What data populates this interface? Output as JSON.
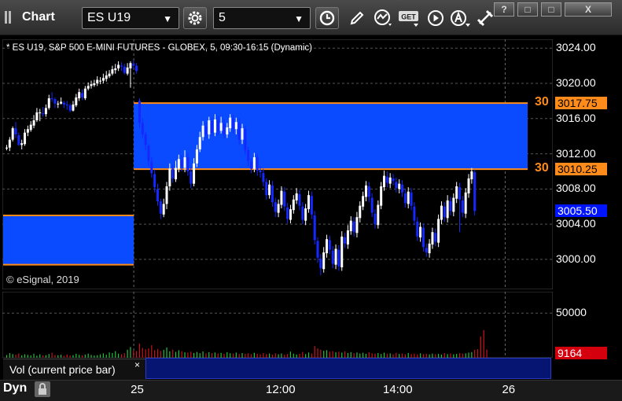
{
  "window": {
    "title": "Chart",
    "symbol": "ES U19",
    "interval": "5",
    "help_btn": "?",
    "restore_btn": "□",
    "maximize_btn": "□",
    "close_btn": "X"
  },
  "chart_info": "* ES U19, S&P 500 E-MINI FUTURES - GLOBEX, 5, 09:30-16:15 (Dynamic)",
  "copyright": "© eSignal, 2019",
  "box_label_top": "30",
  "box_label_bottom": "30",
  "price_tags": {
    "top_box": "3017.75",
    "bottom_box": "3010.25",
    "last": "3005.50",
    "volume": "9164"
  },
  "volume_pane": {
    "label": "Vol (current price bar)",
    "close": "×"
  },
  "bottom_bar": {
    "mode": "Dyn"
  },
  "colors": {
    "box": "#0a4bff",
    "box_border": "#ff8c1a",
    "up_candle": "#ffffff",
    "down_candle": "#1428ff",
    "vol_up": "#22c23a",
    "vol_down": "#c8141e",
    "last_tag": "#0014ff",
    "vol_tag": "#d4000e"
  },
  "chart_data": {
    "type": "candlestick",
    "price_axis": {
      "ticks": [
        "3024.00",
        "3020.00",
        "3016.00",
        "3012.00",
        "3008.00",
        "3004.00",
        "3000.00"
      ],
      "range": [
        2996.6,
        3025.0
      ]
    },
    "volume_axis": {
      "ticks": [
        "50000"
      ],
      "range": [
        0,
        74000
      ]
    },
    "time_axis": {
      "ticks": [
        "25",
        "12:00",
        "14:00",
        "26"
      ]
    },
    "boxes": [
      {
        "from_bar": 43,
        "to_bar": 150,
        "high": 3017.75,
        "low": 3010.25
      },
      {
        "from_bar": 0,
        "to_bar": 43,
        "high": 3005.0,
        "low": 2999.4
      }
    ],
    "day_separators": [
      43,
      166
    ],
    "candles": [
      [
        3012.6,
        3012.7,
        3013.0,
        3012.4
      ],
      [
        3012.7,
        3013.6,
        3013.9,
        3012.3
      ],
      [
        3013.6,
        3014.9,
        3015.1,
        3013.4
      ],
      [
        3014.9,
        3014.2,
        3015.6,
        3013.8
      ],
      [
        3014.1,
        3013.0,
        3014.4,
        3012.9
      ],
      [
        3013.0,
        3013.2,
        3013.6,
        3012.5
      ],
      [
        3013.1,
        3014.4,
        3014.8,
        3012.9
      ],
      [
        3014.4,
        3014.8,
        3015.2,
        3014.0
      ],
      [
        3014.7,
        3015.3,
        3015.7,
        3014.5
      ],
      [
        3015.2,
        3015.8,
        3016.4,
        3014.9
      ],
      [
        3015.8,
        3016.7,
        3017.2,
        3015.6
      ],
      [
        3016.6,
        3016.7,
        3017.1,
        3015.7
      ],
      [
        3016.6,
        3016.5,
        3017.3,
        3016.2
      ],
      [
        3016.5,
        3017.2,
        3017.6,
        3016.2
      ],
      [
        3017.2,
        3018.3,
        3018.7,
        3017.0
      ],
      [
        3018.3,
        3018.2,
        3019.0,
        3017.9
      ],
      [
        3018.2,
        3017.7,
        3018.4,
        3017.2
      ],
      [
        3017.6,
        3017.7,
        3018.0,
        3017.2
      ],
      [
        3017.7,
        3017.9,
        3018.4,
        3017.6
      ],
      [
        3017.8,
        3017.6,
        3018.0,
        3017.2
      ],
      [
        3017.6,
        3017.5,
        3018.0,
        3017.0
      ],
      [
        3017.5,
        3016.9,
        3017.7,
        3016.7
      ],
      [
        3016.9,
        3017.6,
        3018.0,
        3016.8
      ],
      [
        3017.5,
        3018.4,
        3018.8,
        3017.3
      ],
      [
        3018.3,
        3019.0,
        3019.4,
        3018.0
      ],
      [
        3018.9,
        3018.4,
        3019.3,
        3018.1
      ],
      [
        3018.3,
        3019.4,
        3019.7,
        3018.1
      ],
      [
        3019.4,
        3019.7,
        3020.1,
        3019.2
      ],
      [
        3019.7,
        3019.9,
        3020.3,
        3019.4
      ],
      [
        3019.8,
        3020.0,
        3020.4,
        3019.6
      ],
      [
        3020.0,
        3020.4,
        3020.8,
        3019.7
      ],
      [
        3020.3,
        3020.3,
        3020.7,
        3019.9
      ],
      [
        3020.3,
        3020.6,
        3021.1,
        3020.0
      ],
      [
        3020.5,
        3020.9,
        3021.4,
        3020.2
      ],
      [
        3020.8,
        3021.1,
        3021.5,
        3020.6
      ],
      [
        3021.1,
        3021.6,
        3022.0,
        3020.9
      ],
      [
        3021.5,
        3021.7,
        3022.2,
        3021.1
      ],
      [
        3021.7,
        3022.1,
        3022.5,
        3021.4
      ],
      [
        3022.0,
        3021.9,
        3022.4,
        3021.4
      ],
      [
        3021.9,
        3021.2,
        3022.2,
        3021.0
      ],
      [
        3021.1,
        3021.8,
        3022.3,
        3020.9
      ],
      [
        3021.7,
        3022.3,
        3022.5,
        3019.5
      ],
      [
        3022.2,
        3022.0,
        3022.6,
        3021.6
      ],
      [
        3022.0,
        3021.4,
        3022.3,
        3021.1
      ],
      [
        3018.0,
        3015.5,
        3018.3,
        3014.9
      ],
      [
        3015.5,
        3014.2,
        3016.0,
        3013.8
      ],
      [
        3014.2,
        3013.0,
        3014.5,
        3012.4
      ],
      [
        3012.9,
        3011.2,
        3013.1,
        3010.6
      ],
      [
        3011.1,
        3009.8,
        3011.6,
        3009.3
      ],
      [
        3009.7,
        3008.2,
        3010.2,
        3007.6
      ],
      [
        3008.0,
        3006.6,
        3008.6,
        3006.1
      ],
      [
        3006.6,
        3005.2,
        3006.9,
        3004.6
      ],
      [
        3005.1,
        3006.3,
        3006.9,
        3004.8
      ],
      [
        3006.3,
        3008.3,
        3008.8,
        3005.7
      ],
      [
        3008.3,
        3010.3,
        3010.9,
        3007.8
      ],
      [
        3010.3,
        3009.2,
        3010.8,
        3008.7
      ],
      [
        3009.1,
        3010.4,
        3011.2,
        3008.8
      ],
      [
        3010.3,
        3011.4,
        3011.9,
        3009.9
      ],
      [
        3011.3,
        3010.5,
        3011.8,
        3010.0
      ],
      [
        3010.4,
        3011.6,
        3012.4,
        3009.9
      ],
      [
        3011.6,
        3010.0,
        3012.1,
        3009.5
      ],
      [
        3010.0,
        3008.6,
        3010.5,
        3008.1
      ],
      [
        3008.6,
        3010.9,
        3011.5,
        3008.3
      ],
      [
        3010.9,
        3012.5,
        3013.0,
        3010.5
      ],
      [
        3012.5,
        3013.9,
        3014.5,
        3012.2
      ],
      [
        3013.9,
        3015.2,
        3015.7,
        3013.5
      ],
      [
        3015.1,
        3014.2,
        3015.6,
        3013.7
      ],
      [
        3014.2,
        3015.8,
        3016.2,
        3013.7
      ],
      [
        3015.7,
        3014.4,
        3016.1,
        3014.0
      ],
      [
        3014.4,
        3015.9,
        3016.5,
        3014.0
      ],
      [
        3015.8,
        3014.6,
        3016.3,
        3014.1
      ],
      [
        3014.6,
        3015.5,
        3016.2,
        3014.3
      ],
      [
        3015.4,
        3014.2,
        3015.9,
        3013.7
      ],
      [
        3014.2,
        3015.0,
        3015.5,
        3013.8
      ],
      [
        3014.9,
        3016.1,
        3016.5,
        3014.5
      ],
      [
        3016.0,
        3014.8,
        3016.4,
        3014.3
      ],
      [
        3014.8,
        3015.6,
        3016.1,
        3014.2
      ],
      [
        3015.5,
        3013.6,
        3016.0,
        3013.0
      ],
      [
        3013.6,
        3014.9,
        3015.4,
        3013.1
      ],
      [
        3014.8,
        3012.4,
        3015.2,
        3011.9
      ],
      [
        3012.4,
        3011.2,
        3012.8,
        3010.6
      ],
      [
        3011.1,
        3010.3,
        3011.5,
        3009.8
      ],
      [
        3010.3,
        3011.6,
        3012.1,
        3009.9
      ],
      [
        3011.6,
        3010.1,
        3012.0,
        3009.5
      ],
      [
        3010.1,
        3009.9,
        3010.6,
        3009.3
      ],
      [
        3009.8,
        3008.8,
        3010.3,
        3008.3
      ],
      [
        3008.8,
        3007.3,
        3009.2,
        3006.8
      ],
      [
        3007.3,
        3008.5,
        3009.0,
        3006.9
      ],
      [
        3008.4,
        3006.5,
        3008.9,
        3006.0
      ],
      [
        3006.5,
        3005.4,
        3007.0,
        3004.8
      ],
      [
        3005.3,
        3006.3,
        3006.8,
        3004.8
      ],
      [
        3006.2,
        3007.8,
        3008.3,
        3005.8
      ],
      [
        3007.7,
        3006.0,
        3008.2,
        3005.5
      ],
      [
        3005.9,
        3004.6,
        3006.4,
        3004.1
      ],
      [
        3004.5,
        3005.7,
        3006.2,
        3004.1
      ],
      [
        3005.6,
        3006.8,
        3007.3,
        3005.2
      ],
      [
        3006.7,
        3007.5,
        3008.1,
        3006.3
      ],
      [
        3007.4,
        3006.1,
        3007.9,
        3005.6
      ],
      [
        3006.0,
        3004.5,
        3006.5,
        3004.0
      ],
      [
        3004.4,
        3005.8,
        3006.3,
        3003.9
      ],
      [
        3005.7,
        3007.3,
        3007.8,
        3005.3
      ],
      [
        3007.2,
        3005.1,
        3007.7,
        3004.6
      ],
      [
        3005.0,
        3002.2,
        3005.5,
        3001.7
      ],
      [
        3002.1,
        3000.2,
        3002.5,
        2999.6
      ],
      [
        3000.1,
        2999.0,
        3000.6,
        2998.2
      ],
      [
        2998.9,
        3000.8,
        3001.4,
        2998.5
      ],
      [
        3000.7,
        3002.3,
        3002.8,
        3000.2
      ],
      [
        3002.2,
        3001.1,
        3002.7,
        3000.6
      ],
      [
        3001.0,
        2999.5,
        3001.5,
        2999.0
      ],
      [
        2999.4,
        3001.2,
        3001.7,
        2998.9
      ],
      [
        3001.1,
        2999.2,
        3001.6,
        2998.7
      ],
      [
        2999.1,
        3002.6,
        3003.2,
        2998.7
      ],
      [
        3002.5,
        3001.8,
        3003.0,
        3001.3
      ],
      [
        3001.7,
        3003.3,
        3003.9,
        3001.2
      ],
      [
        3003.2,
        3004.4,
        3004.9,
        3002.8
      ],
      [
        3004.3,
        3003.1,
        3004.8,
        3002.6
      ],
      [
        3003.0,
        3004.8,
        3005.4,
        3002.5
      ],
      [
        3004.7,
        3006.1,
        3006.6,
        3004.2
      ],
      [
        3006.0,
        3007.2,
        3007.7,
        3005.6
      ],
      [
        3007.1,
        3008.4,
        3008.9,
        3006.6
      ],
      [
        3008.3,
        3007.1,
        3008.8,
        3006.5
      ],
      [
        3007.0,
        3005.3,
        3007.5,
        3004.8
      ],
      [
        3005.2,
        3004.0,
        3005.7,
        3003.5
      ],
      [
        3003.9,
        3006.2,
        3006.7,
        3003.5
      ],
      [
        3006.1,
        3008.3,
        3008.8,
        3005.7
      ],
      [
        3008.2,
        3009.5,
        3010.1,
        3007.8
      ],
      [
        3009.4,
        3008.7,
        3010.0,
        3008.2
      ],
      [
        3008.6,
        3009.3,
        3009.8,
        3008.1
      ],
      [
        3009.2,
        3008.9,
        3009.7,
        3008.4
      ],
      [
        3008.8,
        3008.1,
        3009.3,
        3007.6
      ],
      [
        3008.0,
        3008.6,
        3009.1,
        3007.5
      ],
      [
        3008.5,
        3007.6,
        3009.0,
        3007.1
      ],
      [
        3007.5,
        3006.4,
        3008.0,
        3005.9
      ],
      [
        3006.3,
        3007.7,
        3008.2,
        3005.8
      ],
      [
        3007.6,
        3006.1,
        3008.1,
        3005.6
      ],
      [
        3006.0,
        3004.4,
        3006.5,
        3003.9
      ],
      [
        3004.3,
        3002.6,
        3004.8,
        3002.1
      ],
      [
        3002.5,
        3003.7,
        3004.2,
        3002.0
      ],
      [
        3003.6,
        3001.4,
        3004.1,
        3000.9
      ],
      [
        3001.3,
        3000.8,
        3001.8,
        3000.3
      ],
      [
        3000.7,
        3001.8,
        3002.3,
        3000.2
      ],
      [
        3001.7,
        3003.1,
        3003.6,
        3001.2
      ],
      [
        3003.0,
        3002.0,
        3003.5,
        3001.5
      ],
      [
        3001.9,
        3004.6,
        3005.1,
        3001.4
      ],
      [
        3004.5,
        3006.1,
        3006.6,
        3004.0
      ],
      [
        3006.0,
        3004.8,
        3006.5,
        3004.3
      ],
      [
        3004.7,
        3006.7,
        3007.3,
        3004.2
      ],
      [
        3006.6,
        3005.5,
        3007.1,
        3005.0
      ],
      [
        3005.4,
        3007.0,
        3007.5,
        3004.9
      ],
      [
        3006.9,
        3008.3,
        3008.8,
        3006.4
      ],
      [
        3008.2,
        3006.8,
        3008.7,
        3003.1
      ],
      [
        3006.7,
        3005.3,
        3007.2,
        3004.8
      ],
      [
        3005.2,
        3007.6,
        3008.1,
        3004.7
      ],
      [
        3007.5,
        3009.2,
        3009.7,
        3007.0
      ],
      [
        3009.1,
        3010.0,
        3010.4,
        3008.6
      ],
      [
        3009.9,
        3005.5,
        3010.2,
        3005.0
      ]
    ],
    "volume": [
      3000,
      5200,
      4100,
      3500,
      4800,
      2700,
      3900,
      3300,
      2600,
      4400,
      2300,
      3800,
      2500,
      2900,
      4200,
      5600,
      3100,
      2800,
      3400,
      2200,
      3700,
      2600,
      3000,
      4500,
      3300,
      2800,
      3500,
      4700,
      3200,
      2600,
      2900,
      3800,
      4900,
      3400,
      6000,
      5300,
      7400,
      4600,
      3900,
      5100,
      9000,
      12000,
      8000,
      7500,
      16000,
      11000,
      9500,
      10500,
      14000,
      8500,
      9800,
      7600,
      8900,
      11500,
      7300,
      9100,
      6600,
      8400,
      7200,
      6100,
      5800,
      6800,
      5400,
      6500,
      5100,
      7100,
      4800,
      6300,
      5200,
      5900,
      4600,
      5500,
      4300,
      6200,
      5000,
      4700,
      5800,
      4200,
      5300,
      4400,
      4900,
      4000,
      5600,
      4500,
      3800,
      5200,
      4100,
      4700,
      3600,
      5000,
      3900,
      4800,
      3500,
      4300,
      6900,
      4600,
      3700,
      4400,
      6500,
      4100,
      5900,
      4800,
      13000,
      10500,
      9000,
      7800,
      8500,
      6900,
      7400,
      6100,
      6800,
      5800,
      7200,
      5400,
      6300,
      5100,
      5900,
      4700,
      5600,
      4400,
      6200,
      5000,
      4600,
      5300,
      4200,
      5700,
      4500,
      4900,
      3900,
      5500,
      4300,
      4800,
      3800,
      5400,
      4200,
      4600,
      3700,
      4900,
      4100,
      4500,
      3800,
      4700,
      4000,
      4400,
      3600,
      5200,
      4100,
      4800,
      3900,
      4300,
      5100,
      4600,
      4900,
      5800,
      6400,
      8800,
      9600,
      24000,
      31000,
      9164
    ]
  }
}
